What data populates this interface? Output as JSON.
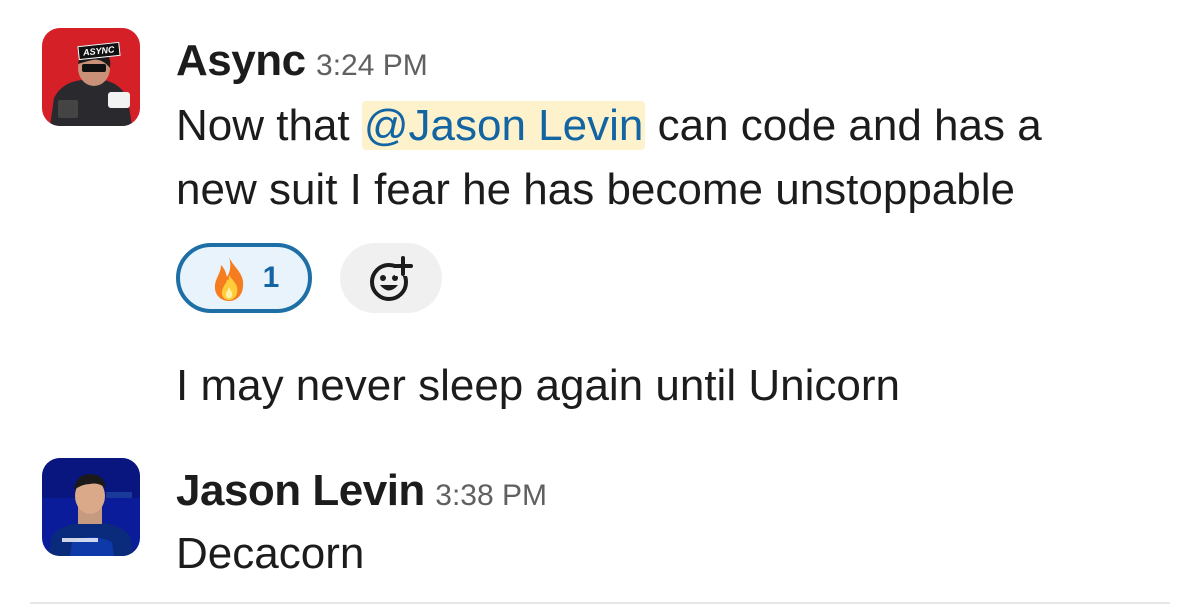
{
  "messages": [
    {
      "sender": "Async",
      "time": "3:24 PM",
      "avatar": {
        "icon": "async-avatar",
        "badge": "ASYNC",
        "bg": "#e8242c"
      },
      "line1_pre": "Now that ",
      "mention": "@Jason Levin",
      "line1_post": " can code and has a",
      "line2": "new suit I fear he has become unstoppable",
      "reaction": {
        "icon": "fire-emoji",
        "count": "1"
      },
      "add_reaction_icon": "add-reaction-icon",
      "followup": "I may never sleep again until Unicorn"
    },
    {
      "sender": "Jason Levin",
      "time": "3:38 PM",
      "avatar": {
        "icon": "jason-levin-avatar",
        "bg": "#0b1c9a"
      },
      "text": "Decacorn"
    }
  ],
  "colors": {
    "mention_bg": "#fdf2cc",
    "mention_text": "#1264a3",
    "reaction_border": "#1d6fa5"
  }
}
